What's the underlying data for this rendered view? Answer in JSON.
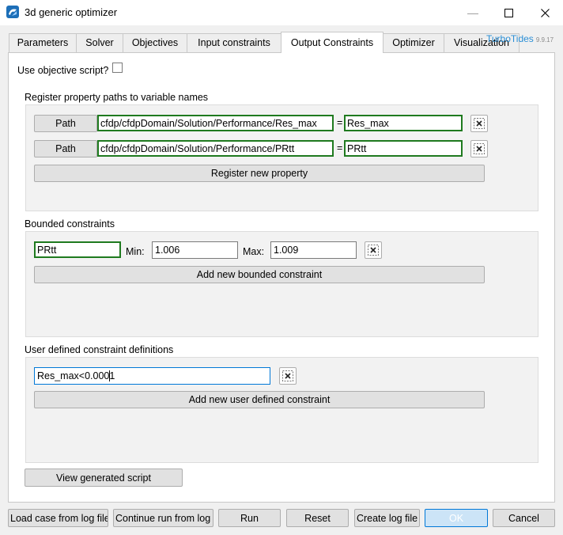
{
  "window": {
    "title": "3d generic optimizer",
    "minimize_glyph": "—",
    "maximize_glyph": "☐",
    "close_glyph": "✕"
  },
  "brand": {
    "name": "TurboTides",
    "version": "9.9.17",
    "color": "#2b8fd6"
  },
  "tabs": [
    {
      "label": "Parameters"
    },
    {
      "label": "Solver"
    },
    {
      "label": "Objectives"
    },
    {
      "label": "Input constraints"
    },
    {
      "label": "Output Constraints",
      "active": true
    },
    {
      "label": "Optimizer"
    },
    {
      "label": "Visualization"
    }
  ],
  "objective_script": {
    "label": "Use objective script?",
    "checked": false
  },
  "register_section": {
    "title": "Register property paths to variable names",
    "equals": "=",
    "rows": [
      {
        "button": "Path",
        "path": "cfdp/cfdpDomain/Solution/Performance/Res_max",
        "name": "Res_max"
      },
      {
        "button": "Path",
        "path": "cfdp/cfdpDomain/Solution/Performance/PRtt",
        "name": "PRtt"
      }
    ],
    "add_button": "Register new property"
  },
  "bounded_section": {
    "title": "Bounded constraints",
    "rows": [
      {
        "name": "PRtt",
        "min_label": "Min:",
        "min": "1.006",
        "max_label": "Max:",
        "max": "1.009"
      }
    ],
    "add_button": "Add new bounded constraint"
  },
  "user_section": {
    "title": "User defined constraint definitions",
    "rows": [
      {
        "text_before_caret": "Res_max<0.000",
        "text_after_caret": "1"
      }
    ],
    "add_button": "Add new user defined constraint"
  },
  "view_script_button": "View generated script",
  "footer": {
    "load": "Load case from log file",
    "continue": "Continue run from log file",
    "run": "Run",
    "reset": "Reset",
    "create_log": "Create log file",
    "ok": "OK",
    "cancel": "Cancel"
  },
  "colors": {
    "accent": "#0078d7",
    "valid_border": "#1f7a1f"
  }
}
